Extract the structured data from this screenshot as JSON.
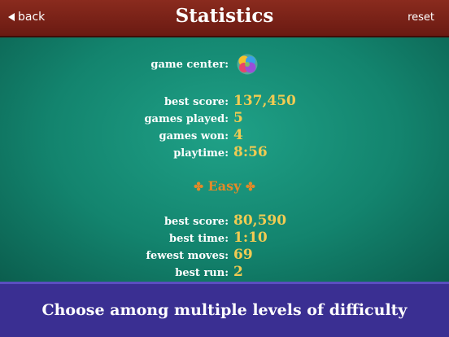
{
  "header": {
    "back_label": "back",
    "title": "Statistics",
    "reset_label": "reset"
  },
  "overall": {
    "game_center_label": "game center:",
    "best_score_label": "best score:",
    "best_score": "137,450",
    "games_played_label": "games played:",
    "games_played": "5",
    "games_won_label": "games won:",
    "games_won": "4",
    "playtime_label": "playtime:",
    "playtime": "8:56"
  },
  "easy": {
    "section_title": "Easy",
    "clover_glyph": "✤",
    "best_score_label": "best score:",
    "best_score": "80,590",
    "best_time_label": "best time:",
    "best_time": "1:10",
    "fewest_moves_label": "fewest moves:",
    "fewest_moves": "69",
    "best_run_label": "best run:",
    "best_run": "2"
  },
  "banner": {
    "text": "Choose among multiple levels of difficulty"
  },
  "colors": {
    "header_red": "#7a2318",
    "felt_green": "#16806d",
    "value_gold": "#f1cb52",
    "section_orange": "#e48a28",
    "banner_purple": "#3a2f92"
  },
  "icons": {
    "back": "back-arrow-icon",
    "game_center": "game-center-icon"
  }
}
